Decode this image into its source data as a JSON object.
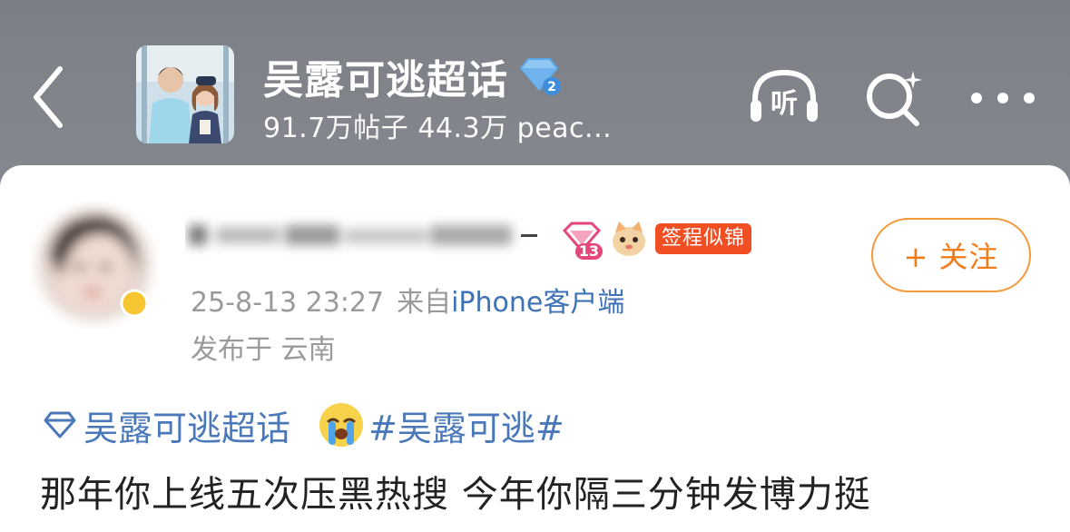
{
  "header": {
    "back_icon": "chevron-left-icon",
    "topic_title": "吴露可逃超话",
    "topic_level": "2",
    "stats": "91.7万帖子 44.3万 peac...",
    "listen_label": "听",
    "icons": [
      "headphones-icon",
      "search-sparkle-icon",
      "more-icon"
    ]
  },
  "post": {
    "level": "13",
    "checkin_tag": "签程似锦",
    "follow_label": "+ 关注",
    "timestamp": "25-8-13 23:27",
    "source_prefix": "来自",
    "source_client": "iPhone客户端",
    "location": "发布于 云南",
    "topic_link": "吴露可逃超话",
    "hashtag": "#吴露可逃#",
    "body": "那年你上线五次压黑热搜 今年你隔三分钟发博力挺"
  },
  "colors": {
    "link_blue": "#4a78b8",
    "follow_orange": "#f07c1a",
    "tag_red": "#f04e23",
    "meta_gray": "#9a9a9a"
  }
}
